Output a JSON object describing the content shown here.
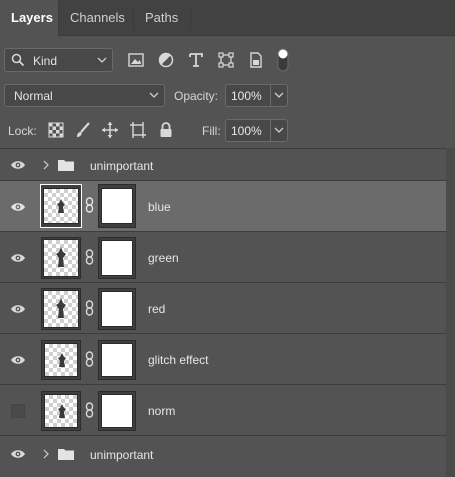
{
  "tabs": [
    {
      "label": "Layers",
      "active": true
    },
    {
      "label": "Channels",
      "active": false
    },
    {
      "label": "Paths",
      "active": false
    }
  ],
  "filter": {
    "kind_label": "Kind",
    "icons": [
      "image-filter-icon",
      "adjustment-filter-icon",
      "type-filter-icon",
      "shape-filter-icon",
      "smart-object-filter-icon",
      "filter-toggle-icon"
    ]
  },
  "blend": {
    "mode": "Normal",
    "opacity_label": "Opacity:",
    "opacity_value": "100%"
  },
  "lock": {
    "label": "Lock:",
    "icons": [
      "lock-transparent-pixels-icon",
      "lock-image-pixels-icon",
      "lock-position-icon",
      "lock-artboard-icon",
      "lock-all-icon"
    ],
    "fill_label": "Fill:",
    "fill_value": "100%"
  },
  "layers": [
    {
      "name": "unimportant",
      "type": "group",
      "visible": true,
      "selected": false
    },
    {
      "name": "blue",
      "type": "layer",
      "visible": true,
      "selected": true
    },
    {
      "name": "green",
      "type": "layer",
      "visible": true,
      "selected": false
    },
    {
      "name": "red",
      "type": "layer",
      "visible": true,
      "selected": false
    },
    {
      "name": "glitch effect",
      "type": "layer",
      "visible": true,
      "selected": false
    },
    {
      "name": "norm",
      "type": "layer",
      "visible": false,
      "selected": false
    },
    {
      "name": "unimportant",
      "type": "group",
      "visible": true,
      "selected": false
    }
  ],
  "colors": {
    "panel_bg": "#535353",
    "tab_bar_bg": "#424242",
    "selected_row_bg": "#6b6b6b",
    "text": "#d6d6d6"
  }
}
